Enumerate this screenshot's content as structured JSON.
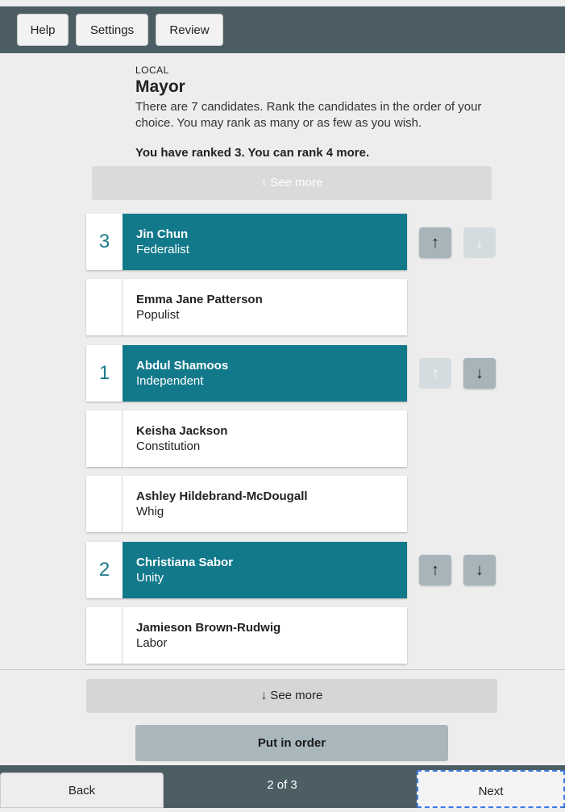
{
  "toolbar": {
    "help": "Help",
    "settings": "Settings",
    "review": "Review"
  },
  "contest": {
    "kicker": "LOCAL",
    "title": "Mayor",
    "description": "There are 7 candidates. Rank the candidates in the order of your choice. You may rank as many or as few as you wish.",
    "status": "You have ranked 3. You can rank 4 more."
  },
  "see_more_up": "↑ See more",
  "candidates": [
    {
      "name": "Jin Chun",
      "party": "Federalist",
      "rank": "3",
      "move_up_icon": "arrow-up",
      "move_down_icon": "arrow-down"
    },
    {
      "name": "Emma Jane Patterson",
      "party": "Populist",
      "rank": ""
    },
    {
      "name": "Abdul Shamoos",
      "party": "Independent",
      "rank": "1",
      "move_up_icon": "arrow-up",
      "move_down_icon": "arrow-down"
    },
    {
      "name": "Keisha Jackson",
      "party": "Constitution",
      "rank": ""
    },
    {
      "name": "Ashley Hildebrand-McDougall",
      "party": "Whig",
      "rank": ""
    },
    {
      "name": "Christiana Sabor",
      "party": "Unity",
      "rank": "2",
      "move_up_icon": "arrow-up",
      "move_down_icon": "arrow-down"
    },
    {
      "name": "Jamieson Brown-Rudwig",
      "party": "Labor",
      "rank": ""
    }
  ],
  "see_more_down": "↓ See more",
  "put_in_order": "Put in order",
  "footer": {
    "back": "Back",
    "page": "2 of 3",
    "next": "Next"
  },
  "colors": {
    "ranked": "#12798b",
    "bar": "#4c5d64",
    "focus": "#3c7be0"
  }
}
